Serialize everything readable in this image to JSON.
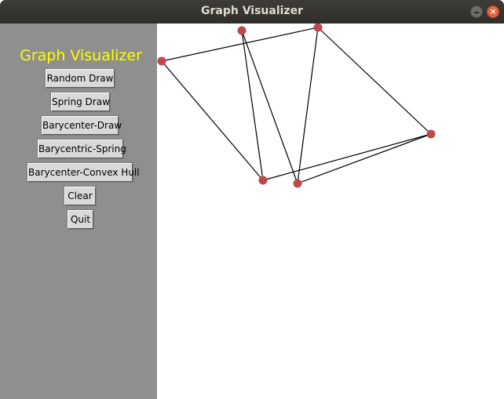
{
  "window": {
    "title": "Graph Visualizer",
    "close_glyph": "×",
    "min_icon": "minimize-icon",
    "close_icon": "close-icon"
  },
  "sidebar": {
    "title": "Graph Visualizer",
    "title_color": "#ffff00",
    "background": "#8f8f8f",
    "buttons": [
      {
        "label": "Random Draw"
      },
      {
        "label": "Spring Draw"
      },
      {
        "label": "Barycenter-Draw"
      },
      {
        "label": "Barycentric-Spring"
      },
      {
        "label": "Barycenter-Convex Hull"
      },
      {
        "label": "Clear"
      },
      {
        "label": "Quit"
      }
    ]
  },
  "graph": {
    "node_color": "#c0474a",
    "edge_color": "#000000",
    "nodes": [
      "n1",
      "n2",
      "n3",
      "n4",
      "n5",
      "n6"
    ],
    "edges": [
      [
        "n1",
        "n3"
      ],
      [
        "n1",
        "n5"
      ],
      [
        "n2",
        "n5"
      ],
      [
        "n2",
        "n6"
      ],
      [
        "n3",
        "n4"
      ],
      [
        "n3",
        "n6"
      ],
      [
        "n4",
        "n5"
      ],
      [
        "n4",
        "n6"
      ]
    ]
  }
}
